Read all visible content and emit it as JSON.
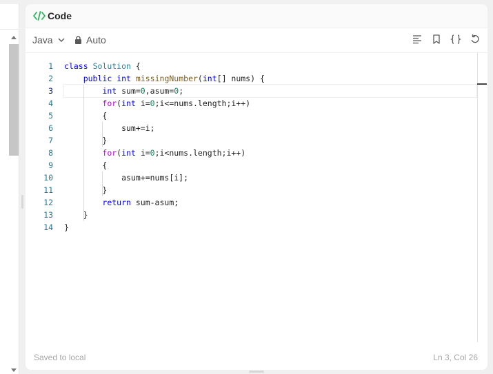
{
  "panel": {
    "title": "Code"
  },
  "toolbar": {
    "language": "Java",
    "mode": "Auto",
    "icons": [
      "format-icon",
      "bookmark-icon",
      "braces-icon",
      "reset-icon"
    ]
  },
  "editor": {
    "active_line": 3,
    "lines": [
      {
        "n": "1",
        "text": "class Solution {"
      },
      {
        "n": "2",
        "text": "    public int missingNumber(int[] nums) {"
      },
      {
        "n": "3",
        "text": "        int sum=0,asum=0;"
      },
      {
        "n": "4",
        "text": "        for(int i=0;i<=nums.length;i++)"
      },
      {
        "n": "5",
        "text": "        {"
      },
      {
        "n": "6",
        "text": "            sum+=i;"
      },
      {
        "n": "7",
        "text": "        }"
      },
      {
        "n": "8",
        "text": "        for(int i=0;i<nums.length;i++)"
      },
      {
        "n": "9",
        "text": "        {"
      },
      {
        "n": "10",
        "text": "            asum+=nums[i];"
      },
      {
        "n": "11",
        "text": "        }"
      },
      {
        "n": "12",
        "text": "        return sum-asum;"
      },
      {
        "n": "13",
        "text": "    }"
      },
      {
        "n": "14",
        "text": "}"
      }
    ]
  },
  "footer": {
    "status": "Saved to local",
    "position": "Ln 3, Col 26"
  },
  "colors": {
    "accent": "#2db55d",
    "keyword": "#0000ff",
    "type": "#267f99",
    "function": "#795e26",
    "number": "#098658",
    "line_number": "#237893"
  }
}
